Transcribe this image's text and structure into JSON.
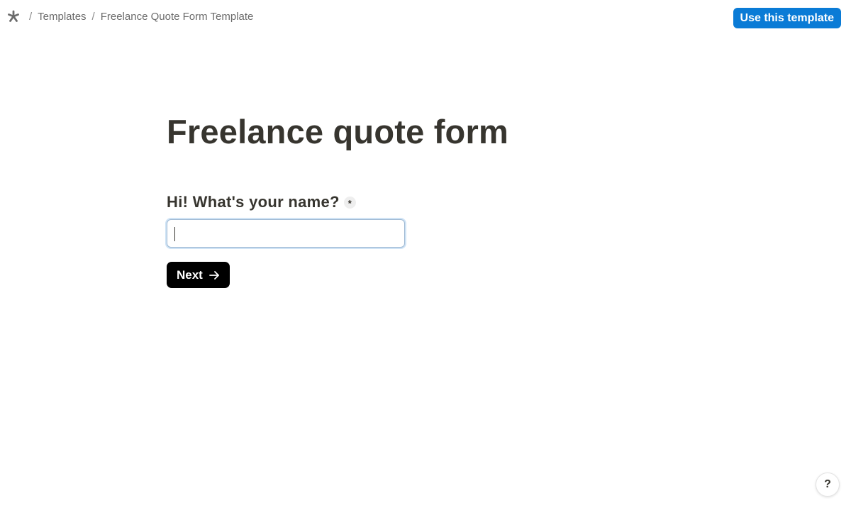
{
  "header": {
    "logo_icon": "asterisk-logo-icon",
    "separator": "/",
    "breadcrumbs": [
      {
        "label": "Templates"
      },
      {
        "label": "Freelance Quote Form Template"
      }
    ],
    "use_template_label": "Use this template",
    "accent_color": "#0a7bd6"
  },
  "form": {
    "title": "Freelance quote form",
    "question": {
      "label": "Hi! What's your name?",
      "required_marker": "*",
      "value": ""
    },
    "next_label": "Next",
    "next_icon": "arrow-right-icon"
  },
  "help": {
    "label": "?",
    "icon": "help-icon"
  }
}
